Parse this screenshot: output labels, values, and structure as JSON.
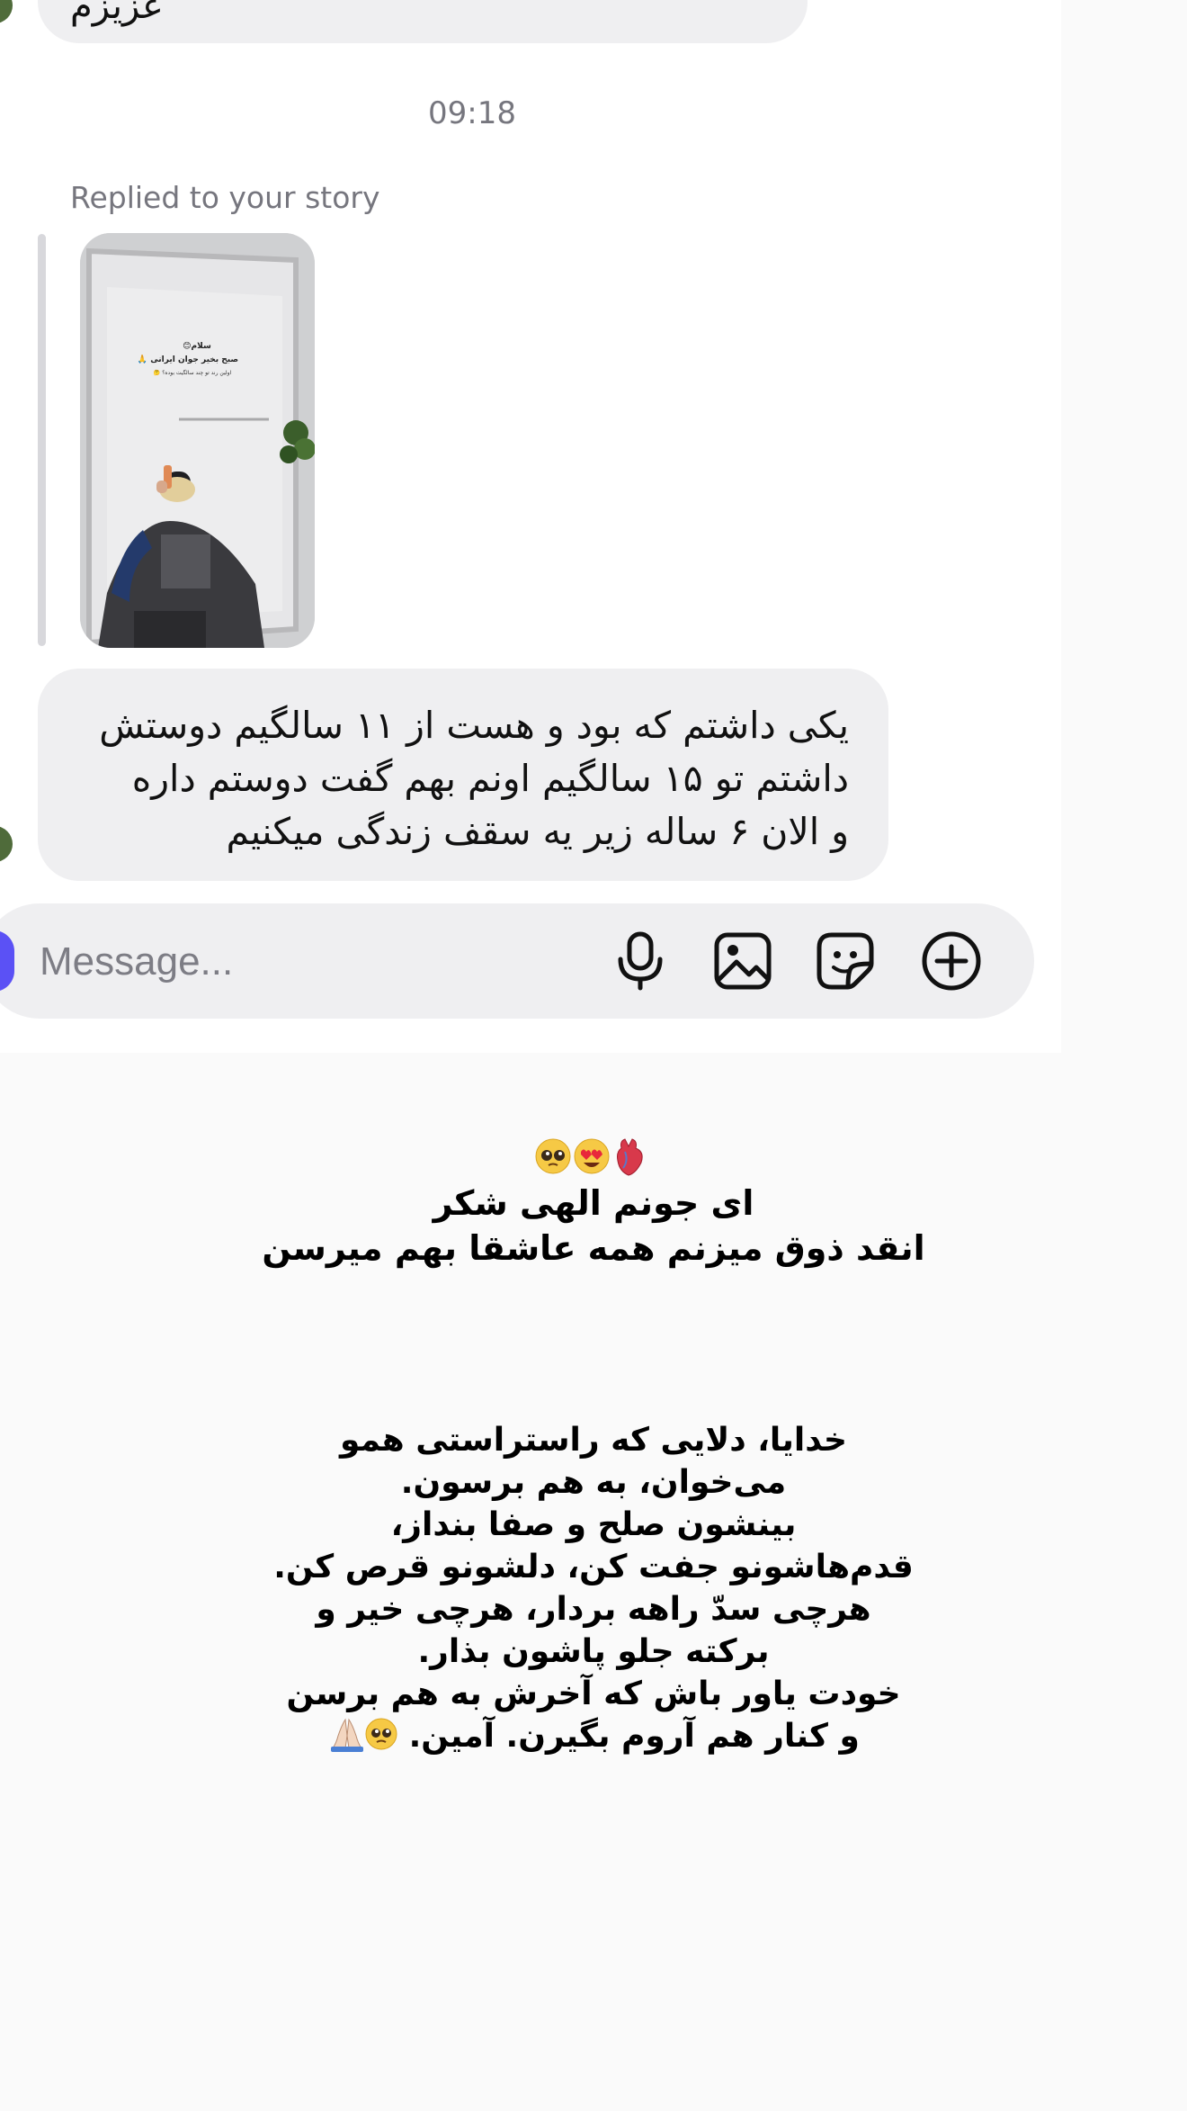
{
  "thread": {
    "top_message_fragment": "عزیزم",
    "timestamp": "09:18",
    "reply_label": "Replied to your story",
    "story_overlay": {
      "line1": "سلام😊",
      "line2": "صبح بخیر جوان ایرانی 🙏",
      "line3": "اولین رند تو چند سالگیت بوده؟ 🤔"
    },
    "message_lines": [
      "یکی داشتم که بود و هست از ۱۱ سالگیم دوستش",
      "داشتم تو ۱۵ سالگیم اونم بهم گفت دوستم داره",
      "و الان ۶ ساله زیر یه سقف زندگی میکنیم"
    ]
  },
  "composer": {
    "placeholder": "Message...",
    "icons": [
      "microphone-icon",
      "image-icon",
      "sticker-icon",
      "plus-circle-icon"
    ]
  },
  "caption": {
    "emoji_icons": [
      "pleading-face-emoji",
      "heart-eyes-emoji",
      "anatomical-heart-emoji"
    ],
    "intro_lines": [
      "ای جونم الهی شکر",
      "انقد ذوق میزنم همه عاشقا بهم میرسن"
    ],
    "prayer_lines": [
      "خدایا، دلایی که راستراستی همو",
      "می‌خوان، به هم برسون.",
      "بینشون صلح و صفا بنداز،",
      "قدم‌هاشونو جفت کن، دلشونو قرص کن.",
      "هرچی سدّ راهه بردار، هرچی خیر و",
      "برکته جلو پاشون بذار.",
      "خودت یاور باش که آخرش به هم برسن",
      "و کنار هم آروم بگیرن. آمین."
    ],
    "prayer_end_icons": [
      "folded-hands-emoji",
      "pleading-face-emoji"
    ]
  }
}
